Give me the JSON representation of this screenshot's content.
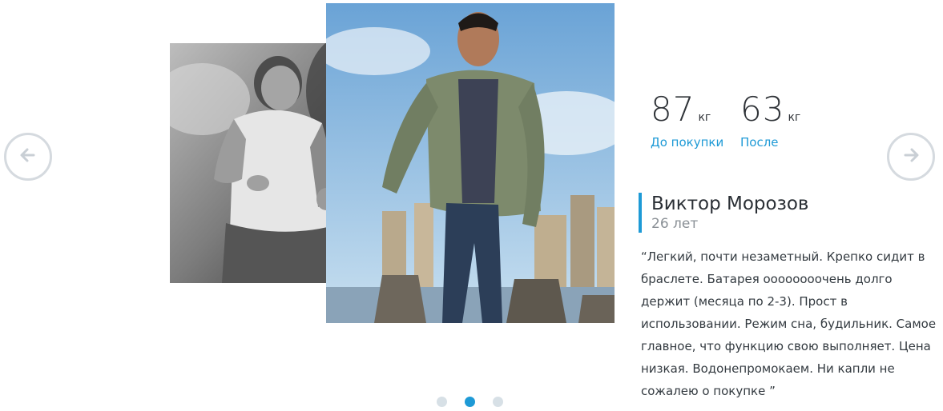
{
  "stats": {
    "before": {
      "value": "87",
      "unit": "кг",
      "caption": "До покупки"
    },
    "after": {
      "value": "63",
      "unit": "кг",
      "caption": "После"
    }
  },
  "person": {
    "name": "Виктор Морозов",
    "age": "26 лет"
  },
  "review": "“Легкий, почти незаметный. Крепко сидит в браслете. Батарея оооооооочень долго держит (месяца по 2-3). Прост в использовании. Режим сна, будильник. Самое главное, что функцию свою выполняет. Цена низкая.  Водонепромокаем. Ни капли не сожалею о покупке ”",
  "carousel": {
    "slide_count": 3,
    "active_index": 1
  },
  "icons": {
    "prev": "arrow-left-icon",
    "next": "arrow-right-icon"
  },
  "colors": {
    "accent": "#1e9ad6",
    "arrow_border": "#d5dadf",
    "dot_inactive": "#d7e0e6"
  }
}
